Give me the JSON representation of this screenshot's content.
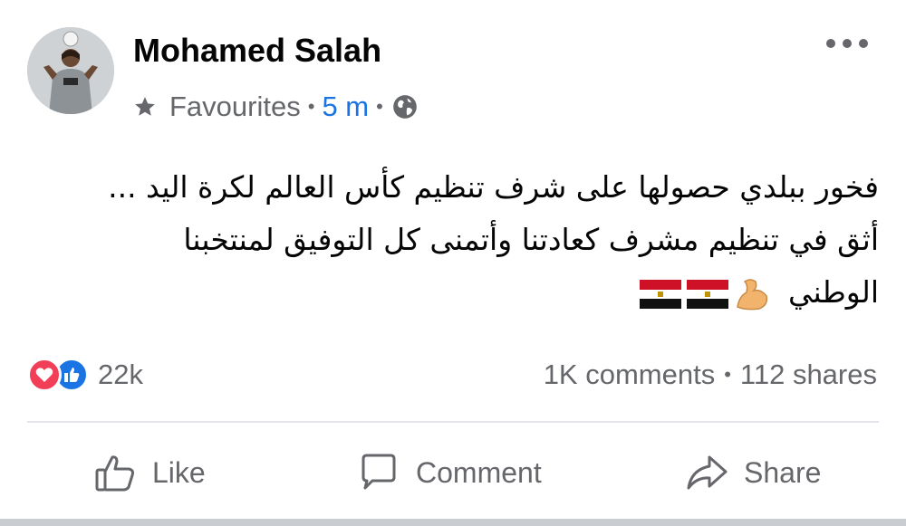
{
  "post": {
    "author": "Mohamed Salah",
    "meta": {
      "audience": "Favourites",
      "separator": "•",
      "time": "5 m",
      "star_icon": "star-icon",
      "privacy_icon": "globe-icon"
    },
    "text_lines": [
      "فخور ببلدي حصولها على شرف تنظيم كأس العالم لكرة اليد ...",
      "أثق في تنظيم مشرف كعادتنا وأتمنى كل التوفيق لمنتخبنا",
      "الوطني"
    ],
    "emojis": [
      "flexed-biceps-emoji",
      "egypt-flag-emoji",
      "egypt-flag-emoji"
    ],
    "reactions": {
      "icons": [
        "love-reaction-icon",
        "like-reaction-icon"
      ],
      "count": "22k"
    },
    "stats": {
      "comments": "1K comments",
      "separator": "•",
      "shares": "112 shares"
    },
    "actions": {
      "like": "Like",
      "comment": "Comment",
      "share": "Share"
    }
  },
  "colors": {
    "text": "#050505",
    "secondary": "#65676b",
    "link_blue": "#1b74e4",
    "love_red": "#f33e58",
    "divider": "#e4e6eb"
  }
}
